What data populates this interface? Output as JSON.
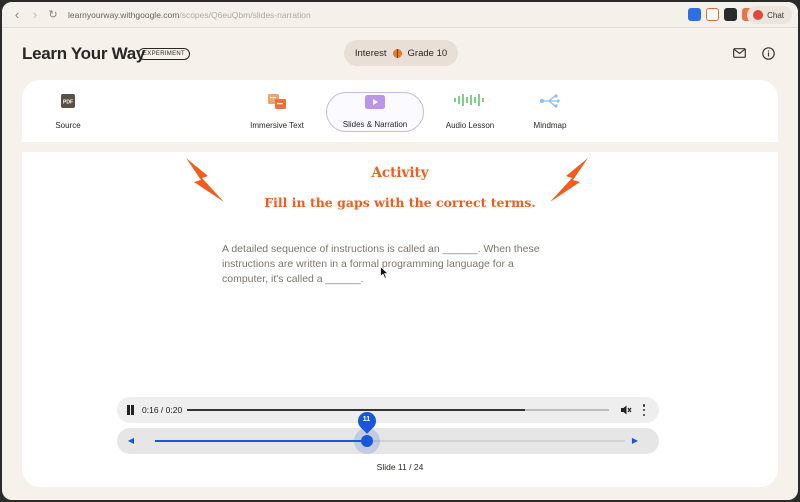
{
  "browser": {
    "url_host": "learnyourway.withgoogle.com",
    "url_path": "/scopes/Q6euQbm/slides-narration",
    "chat_label": "Chat",
    "back_icon": "arrow-left-icon",
    "forward_icon": "arrow-right-icon",
    "reload_icon": "reload-icon"
  },
  "header": {
    "title": "Learn Your Way",
    "badge": "EXPERIMENT",
    "interest_label": "Interest",
    "interest_icon": "basketball-icon",
    "grade_label": "Grade 10",
    "mail_icon": "mail-icon",
    "info_icon": "info-icon"
  },
  "tabs": [
    {
      "label": "Source",
      "icon": "pdf-icon",
      "active": false
    },
    {
      "label": "Immersive Text",
      "icon": "immersive-text-icon",
      "active": false
    },
    {
      "label": "Slides & Narration",
      "icon": "play-slide-icon",
      "active": true
    },
    {
      "label": "Audio Lesson",
      "icon": "waveform-icon",
      "active": false
    },
    {
      "label": "Mindmap",
      "icon": "mindmap-icon",
      "active": false
    }
  ],
  "slide": {
    "title": "Activity",
    "subtitle": "Fill in the gaps with the correct terms.",
    "passage": "A detailed sequence of instructions is called an ______. When these instructions are written in a formal programming language for a computer, it's called a ______."
  },
  "audio": {
    "time": "0:16 / 0:20",
    "progress": 0.8
  },
  "slider": {
    "current": "11",
    "fraction": 0.45,
    "slide_count": "Slide 11 / 24"
  },
  "colors": {
    "accent_orange": "#f25c1d",
    "accent_blue": "#1a56db",
    "background": "#f6f1ea"
  }
}
